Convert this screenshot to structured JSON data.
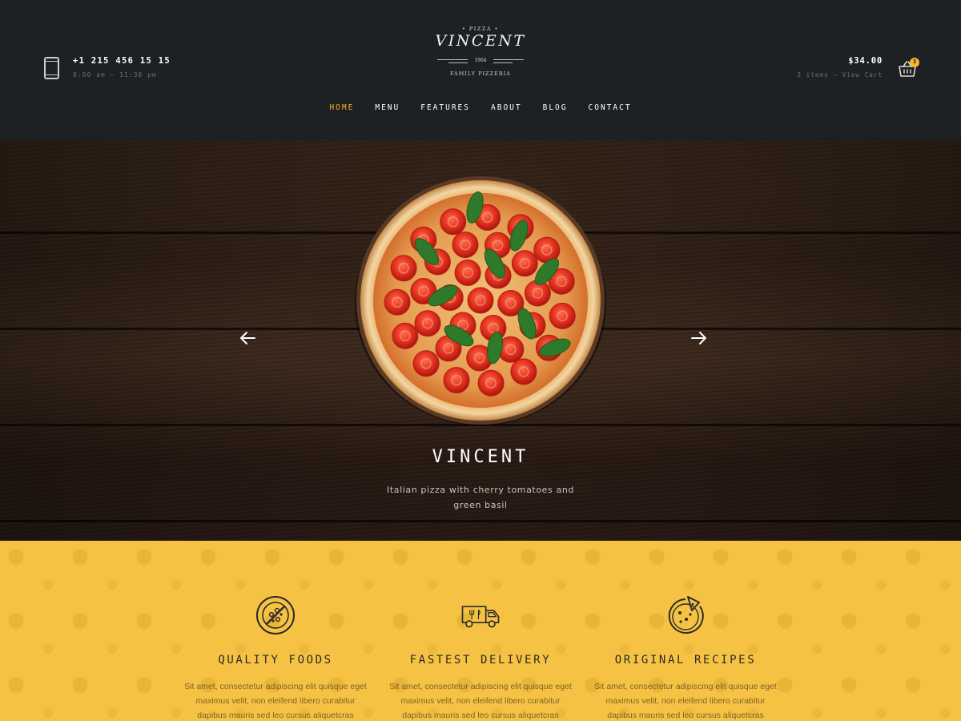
{
  "header": {
    "phone": "+1 215 456 15 15",
    "hours": "8:00 am – 11:30 pm",
    "logo": {
      "top": "• PIZZA •",
      "name": "VINCENT",
      "year": "1964",
      "sub": "FAMILY PIZZERIA"
    },
    "cart": {
      "total": "$34.00",
      "items": "3 items – View Cart",
      "badge": "3"
    },
    "nav": [
      "HOME",
      "MENU",
      "FEATURES",
      "ABOUT",
      "BLOG",
      "CONTACT"
    ],
    "active_nav": "HOME"
  },
  "hero": {
    "title": "VINCENT",
    "description": "Italian pizza with cherry tomatoes and green basil"
  },
  "features": [
    {
      "icon": "pizza-plate-icon",
      "title": "QUALITY FOODS",
      "text": "Sit amet, consectetur adipiscing elit quisque eget maximus velit, non eleifend libero curabitur dapibus mauris sed leo cursus aliquetcras suscipit."
    },
    {
      "icon": "delivery-truck-icon",
      "title": "FASTEST DELIVERY",
      "text": "Sit amet, consectetur adipiscing elit quisque eget maximus velit, non eleifend libero curabitur dapibus mauris sed leo cursus aliquetcras suscipit."
    },
    {
      "icon": "pizza-slice-icon",
      "title": "ORIGINAL RECIPES",
      "text": "Sit amet, consectetur adipiscing elit quisque eget maximus velit, non eleifend libero curabitur dapibus mauris sed leo cursus aliquetcras suscipit."
    }
  ],
  "colors": {
    "accent": "#f5b52e",
    "header_bg": "#1d2023",
    "features_bg": "#f6c244"
  }
}
